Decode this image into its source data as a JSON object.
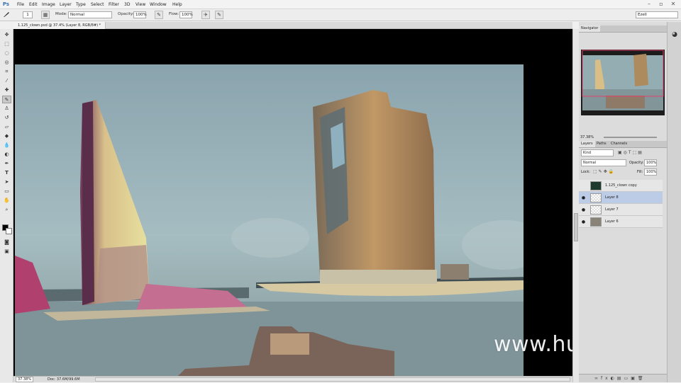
{
  "app": {
    "logo": "Ps"
  },
  "menu": [
    "File",
    "Edit",
    "Image",
    "Layer",
    "Type",
    "Select",
    "Filter",
    "3D",
    "View",
    "Window",
    "Help"
  ],
  "window_controls": [
    "–",
    "▫",
    "✕"
  ],
  "options": {
    "brush_size": "1",
    "mode_label": "Mode:",
    "mode_value": "Normal",
    "opacity_label": "Opacity:",
    "opacity_value": "100%",
    "flow_label": "Flow:",
    "flow_value": "100%",
    "workspace": "Ezell"
  },
  "document": {
    "tab": "1.125_clown.psd @ 37.4% (Layer 8, RGB/8#) *",
    "zoom": "37.38%",
    "doc_info": "Doc: 37.6M/99.6M"
  },
  "panels": {
    "navigator_tab": "Navigator",
    "nav_zoom": "37.38%",
    "layer_tabs": [
      "Layers",
      "Paths",
      "Channels"
    ],
    "kind": "Kind",
    "blend_mode": "Normal",
    "opacity_label": "Opacity:",
    "opacity_value": "100%",
    "lock_label": "Lock:",
    "fill_label": "Fill:",
    "fill_value": "100%",
    "layers": [
      {
        "name": "1.125_clown copy",
        "visible": false,
        "selected": false
      },
      {
        "name": "Layer 8",
        "visible": true,
        "selected": true
      },
      {
        "name": "Layer 7",
        "visible": true,
        "selected": false
      },
      {
        "name": "Layer 6",
        "visible": true,
        "selected": false
      }
    ]
  },
  "watermark": "www.hunls.com",
  "colors": {
    "accent": "#3a6fb0",
    "selected_layer": "#bccbe6"
  }
}
